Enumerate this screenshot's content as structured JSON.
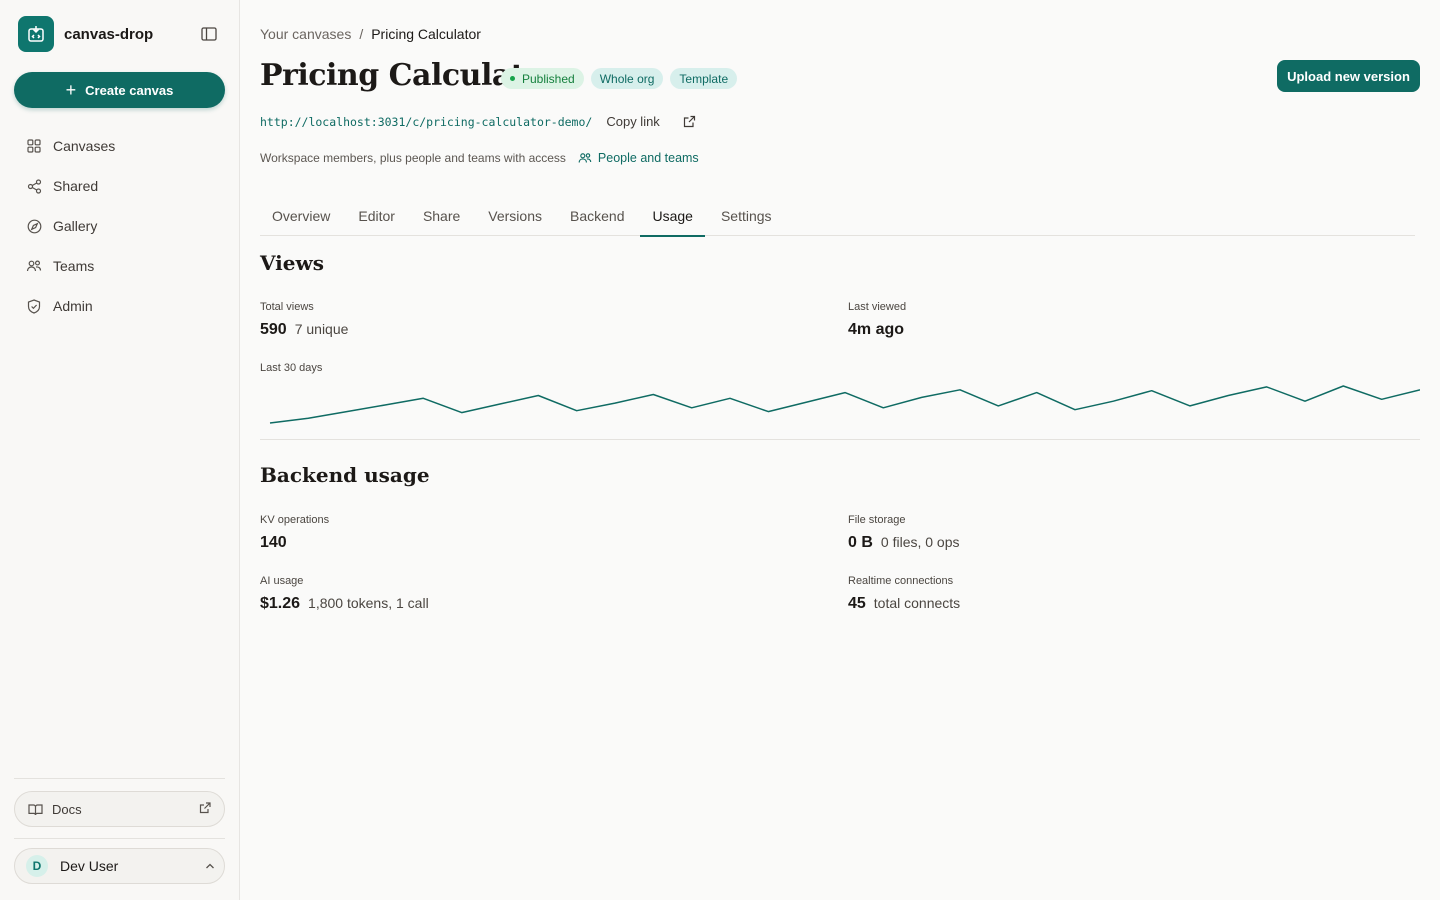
{
  "app": {
    "name": "canvas-drop"
  },
  "sidebar": {
    "create_label": "Create canvas",
    "items": [
      {
        "label": "Canvases",
        "icon": "grid-icon"
      },
      {
        "label": "Shared",
        "icon": "share-icon"
      },
      {
        "label": "Gallery",
        "icon": "compass-icon"
      },
      {
        "label": "Teams",
        "icon": "users-icon"
      },
      {
        "label": "Admin",
        "icon": "shield-icon"
      }
    ],
    "docs_label": "Docs",
    "user": {
      "initial": "D",
      "name": "Dev User"
    }
  },
  "breadcrumb": {
    "parent": "Your canvases",
    "separator": "/",
    "current": "Pricing Calculator"
  },
  "page": {
    "title": "Pricing Calculator",
    "badges": {
      "published": "Published",
      "scope": "Whole org",
      "template": "Template"
    },
    "upload_label": "Upload new version",
    "url": "http://localhost:3031/c/pricing-calculator-demo/",
    "copy_link": "Copy link",
    "access_text": "Workspace members, plus people and teams with access",
    "people_link": "People and teams"
  },
  "tabs": [
    {
      "label": "Overview"
    },
    {
      "label": "Editor"
    },
    {
      "label": "Share"
    },
    {
      "label": "Versions"
    },
    {
      "label": "Backend"
    },
    {
      "label": "Usage",
      "active": true
    },
    {
      "label": "Settings"
    }
  ],
  "views": {
    "title": "Views",
    "total_label": "Total views",
    "total_value": "590",
    "total_sub": "7 unique",
    "last_label": "Last viewed",
    "last_value": "4m ago",
    "spark_label": "Last 30 days",
    "daily": [
      2,
      7,
      14,
      21,
      28,
      13,
      22,
      31,
      15,
      23,
      32,
      18,
      28,
      14,
      24,
      34,
      18,
      29,
      37,
      20,
      34,
      16,
      25,
      36,
      20,
      31,
      40,
      25,
      41,
      27,
      37
    ]
  },
  "backend": {
    "title": "Backend usage",
    "kv_label": "KV operations",
    "kv_value": "140",
    "file_label": "File storage",
    "file_value": "0 B",
    "file_sub": "0 files, 0 ops",
    "ai_label": "AI usage",
    "ai_value": "$1.26",
    "ai_sub": "1,800 tokens, 1 call",
    "rt_label": "Realtime connections",
    "rt_value": "45",
    "rt_sub": "total connects"
  },
  "colors": {
    "accent": "#0f6b63",
    "published": "#15803d"
  }
}
